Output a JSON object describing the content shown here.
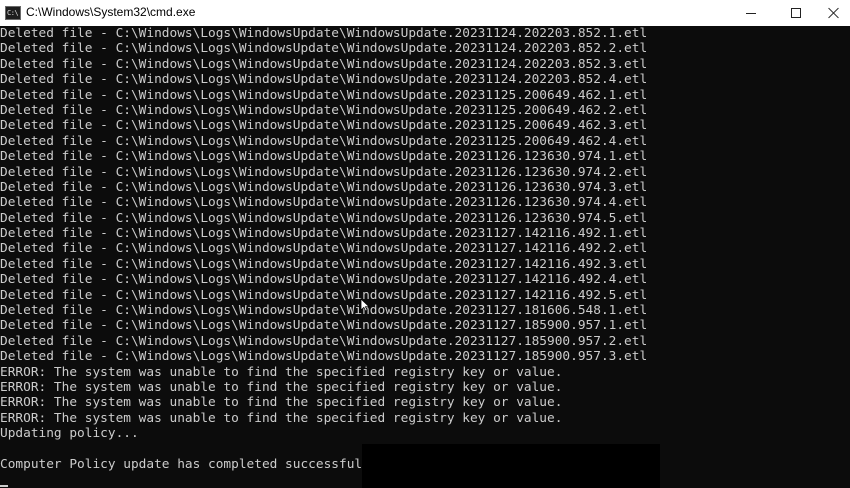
{
  "window": {
    "title": "C:\\Windows\\System32\\cmd.exe",
    "icon_label": "C:\\",
    "icon": "command-prompt-icon",
    "controls": [
      "minimize-icon",
      "maximize-icon",
      "close-icon"
    ]
  },
  "console": {
    "lines": [
      "Deleted file - C:\\Windows\\Logs\\WindowsUpdate\\WindowsUpdate.20231124.202203.852.1.etl",
      "Deleted file - C:\\Windows\\Logs\\WindowsUpdate\\WindowsUpdate.20231124.202203.852.2.etl",
      "Deleted file - C:\\Windows\\Logs\\WindowsUpdate\\WindowsUpdate.20231124.202203.852.3.etl",
      "Deleted file - C:\\Windows\\Logs\\WindowsUpdate\\WindowsUpdate.20231124.202203.852.4.etl",
      "Deleted file - C:\\Windows\\Logs\\WindowsUpdate\\WindowsUpdate.20231125.200649.462.1.etl",
      "Deleted file - C:\\Windows\\Logs\\WindowsUpdate\\WindowsUpdate.20231125.200649.462.2.etl",
      "Deleted file - C:\\Windows\\Logs\\WindowsUpdate\\WindowsUpdate.20231125.200649.462.3.etl",
      "Deleted file - C:\\Windows\\Logs\\WindowsUpdate\\WindowsUpdate.20231125.200649.462.4.etl",
      "Deleted file - C:\\Windows\\Logs\\WindowsUpdate\\WindowsUpdate.20231126.123630.974.1.etl",
      "Deleted file - C:\\Windows\\Logs\\WindowsUpdate\\WindowsUpdate.20231126.123630.974.2.etl",
      "Deleted file - C:\\Windows\\Logs\\WindowsUpdate\\WindowsUpdate.20231126.123630.974.3.etl",
      "Deleted file - C:\\Windows\\Logs\\WindowsUpdate\\WindowsUpdate.20231126.123630.974.4.etl",
      "Deleted file - C:\\Windows\\Logs\\WindowsUpdate\\WindowsUpdate.20231126.123630.974.5.etl",
      "Deleted file - C:\\Windows\\Logs\\WindowsUpdate\\WindowsUpdate.20231127.142116.492.1.etl",
      "Deleted file - C:\\Windows\\Logs\\WindowsUpdate\\WindowsUpdate.20231127.142116.492.2.etl",
      "Deleted file - C:\\Windows\\Logs\\WindowsUpdate\\WindowsUpdate.20231127.142116.492.3.etl",
      "Deleted file - C:\\Windows\\Logs\\WindowsUpdate\\WindowsUpdate.20231127.142116.492.4.etl",
      "Deleted file - C:\\Windows\\Logs\\WindowsUpdate\\WindowsUpdate.20231127.142116.492.5.etl",
      "Deleted file - C:\\Windows\\Logs\\WindowsUpdate\\WindowsUpdate.20231127.181606.548.1.etl",
      "Deleted file - C:\\Windows\\Logs\\WindowsUpdate\\WindowsUpdate.20231127.185900.957.1.etl",
      "Deleted file - C:\\Windows\\Logs\\WindowsUpdate\\WindowsUpdate.20231127.185900.957.2.etl",
      "Deleted file - C:\\Windows\\Logs\\WindowsUpdate\\WindowsUpdate.20231127.185900.957.3.etl",
      "ERROR: The system was unable to find the specified registry key or value.",
      "ERROR: The system was unable to find the specified registry key or value.",
      "ERROR: The system was unable to find the specified registry key or value.",
      "ERROR: The system was unable to find the specified registry key or value.",
      "Updating policy...",
      "",
      "Computer Policy update has completed successfully."
    ]
  }
}
